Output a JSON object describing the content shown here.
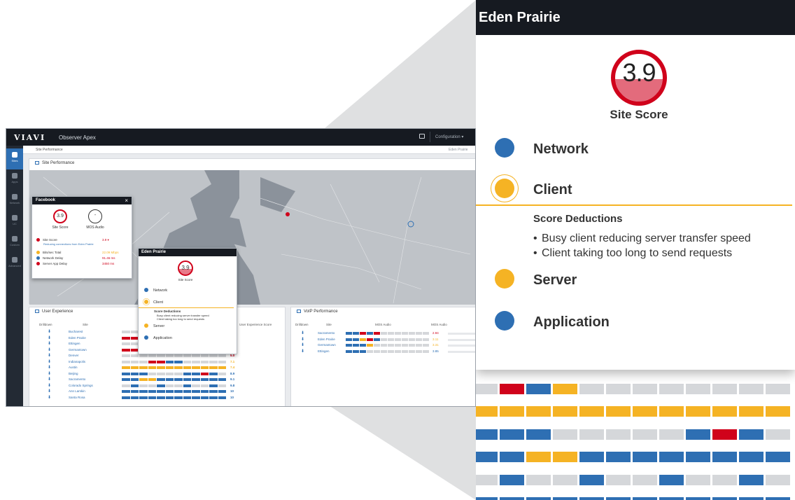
{
  "app": {
    "logo": "VIAVI",
    "product": "Observer Apex",
    "config_label": "Configuration ▾",
    "breadcrumb": "Site Performance",
    "site_selector": "Eden Prairie",
    "nav": [
      {
        "label": "Sites",
        "icon": "sites-icon"
      },
      {
        "label": "Apps",
        "icon": "apps-icon"
      },
      {
        "label": "Network",
        "icon": "network-icon"
      },
      {
        "label": "UC",
        "icon": "uc-icon"
      },
      {
        "label": "Custom",
        "icon": "custom-icon"
      },
      {
        "label": "Advanced",
        "icon": "advanced-icon"
      }
    ],
    "map_panel_title": "Site Performance",
    "ux_panel_title": "User Experience",
    "voip_panel_title": "VoIP Performance",
    "ux_headers": {
      "drilldown": "Drilldown",
      "site": "Site",
      "score": "User Experience Score"
    },
    "voip_headers": {
      "drilldown": "Drilldown",
      "site": "Site",
      "mos": "MOS Audio",
      "mos_short": "MOS Audio"
    },
    "ux_rows": [
      {
        "site": "Bucharest",
        "score": "1.6",
        "color": "#d0021b"
      },
      {
        "site": "Eden Prairie",
        "score": "4.3",
        "color": "#d0021b"
      },
      {
        "site": "Ettingen",
        "score": "4.4",
        "color": "#d0021b"
      },
      {
        "site": "Germantown",
        "score": "4.6",
        "color": "#d0021b"
      },
      {
        "site": "Denver",
        "score": "5.0",
        "color": "#d0021b"
      },
      {
        "site": "Indianapolis",
        "score": "7.1",
        "color": "#f5b324"
      },
      {
        "site": "Austin",
        "score": "7.4",
        "color": "#f5b324"
      },
      {
        "site": "Beijing",
        "score": "8.9",
        "color": "#2e6fb3"
      },
      {
        "site": "Sacramento",
        "score": "9.1",
        "color": "#2e6fb3"
      },
      {
        "site": "Colorado Springs",
        "score": "9.8",
        "color": "#2e6fb3"
      },
      {
        "site": "Ann Lamkin",
        "score": "10",
        "color": "#2e6fb3"
      },
      {
        "site": "Santa Rosa",
        "score": "10",
        "color": "#2e6fb3"
      }
    ],
    "voip_rows": [
      {
        "site": "Sacramento",
        "value": "2.94",
        "color": "#d0021b"
      },
      {
        "site": "Eden Prairie",
        "value": "3.11",
        "color": "#f5b324"
      },
      {
        "site": "Germantown",
        "value": "3.31",
        "color": "#f5b324"
      },
      {
        "site": "Ettingen",
        "value": "3.85",
        "color": "#2e6fb3"
      }
    ],
    "facebook_popup": {
      "title": "Facebook",
      "site_score": "3.9",
      "site_score_label": "Site Score",
      "mos_value": "-",
      "mos_label": "MOS Audio",
      "rows": [
        {
          "label": "Site Score",
          "value": "3.9 ▾",
          "color": "#d0021b",
          "value_color": "#d0021b"
        },
        {
          "label": "Bits/sec Total",
          "value": "22.09 Mbps",
          "color": "#f5b324",
          "value_color": "#f5b324"
        },
        {
          "label": "Network Delay",
          "value": "91.46 ms",
          "color": "#2e6fb3",
          "value_color": "#d0021b"
        },
        {
          "label": "Server App Delay",
          "value": "3450 ms",
          "color": "#d0021b",
          "value_color": "#d0021b"
        }
      ],
      "sub_note": "Reducing connections from Eden Prairie"
    },
    "eden_popup": {
      "title": "Eden Prairie",
      "score": "3.9",
      "score_label": "Site Score",
      "items": [
        "Network",
        "Client",
        "Server",
        "Application"
      ],
      "deductions_title": "Score Deductions",
      "deductions": [
        "Busy client reducing server transfer speed",
        "Client taking too long to send requests"
      ]
    }
  },
  "zoom": {
    "title": "Eden Prairie",
    "score": "3.9",
    "score_label": "Site Score",
    "score_color": "#d0021b",
    "items": [
      {
        "label": "Network",
        "color": "#2e6fb3"
      },
      {
        "label": "Client",
        "color": "#f5b324"
      },
      {
        "label": "Server",
        "color": "#f5b324"
      },
      {
        "label": "Application",
        "color": "#2e6fb3"
      }
    ],
    "deductions_title": "Score Deductions",
    "deductions": [
      "Busy client reducing server transfer speed",
      "Client taking too long to send requests"
    ],
    "bar_colors": {
      "blue": "#2e6fb3",
      "yellow": "#f5b324",
      "red": "#d0021b",
      "grey": "#d5d7da"
    },
    "bar_rows": [
      [
        "g",
        "r",
        "b",
        "y",
        "g",
        "g",
        "g",
        "g",
        "g",
        "g",
        "g",
        "g"
      ],
      [
        "y",
        "y",
        "y",
        "y",
        "y",
        "y",
        "y",
        "y",
        "y",
        "y",
        "y",
        "y"
      ],
      [
        "b",
        "b",
        "b",
        "g",
        "g",
        "g",
        "g",
        "g",
        "b",
        "r",
        "b",
        "g"
      ],
      [
        "b",
        "b",
        "y",
        "y",
        "b",
        "b",
        "b",
        "b",
        "b",
        "b",
        "b",
        "b"
      ],
      [
        "g",
        "b",
        "g",
        "g",
        "b",
        "g",
        "g",
        "b",
        "g",
        "g",
        "b",
        "g"
      ],
      [
        "b",
        "b",
        "b",
        "b",
        "b",
        "b",
        "b",
        "b",
        "b",
        "b",
        "b",
        "b"
      ]
    ]
  }
}
